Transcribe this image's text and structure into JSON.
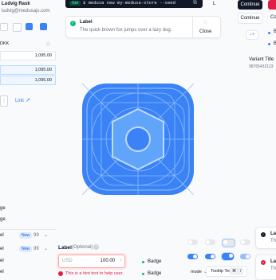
{
  "user": {
    "name": "Ludvig Rask",
    "email": "ludvig@medusajs.com"
  },
  "terminal": {
    "tag": "Get",
    "command": "$ medusa new my-medusa-store --seed",
    "side_key": "L"
  },
  "toast": {
    "title": "Label",
    "message": "The quick brown fox jumps over a lazy dog.",
    "close": "Close"
  },
  "buttons": {
    "continue_dark": "Continue",
    "continue_light": "Continue",
    "continue_light2": "Co"
  },
  "radio_items": [
    "B",
    "B"
  ],
  "variant": {
    "title": "Variant Title",
    "code": "98765432123"
  },
  "currency": {
    "code": "DKK"
  },
  "price_cells": [
    "1,095.00",
    "1,095.00",
    "1,095.00"
  ],
  "link": {
    "label": "Link"
  },
  "left_list": {
    "labels": [
      "ge",
      "ge"
    ],
    "rows": [
      {
        "label": "el",
        "badge": "New",
        "num": "99"
      },
      {
        "label": "el",
        "badge": "New",
        "num": "99"
      }
    ],
    "bottom": [
      "el",
      "el"
    ]
  },
  "price_field": {
    "label": "Label",
    "optional": "(Optional)",
    "currency": "USD",
    "value": "100.00",
    "hint": "This is a hint text to help user."
  },
  "badges": [
    "Badge",
    "Badge"
  ],
  "misc": {
    "mode": "mode",
    "tooltip": "Tooltip Text",
    "key1": "⌘",
    "key2": "/"
  },
  "right_alerts": [
    {
      "title": "La",
      "body": "Th"
    },
    {
      "title": "La",
      "body": "Th"
    }
  ],
  "colors": {
    "app_icon": "#3b82f6",
    "accent": "#3b82f6",
    "error": "#e11d48",
    "success": "#10b981"
  }
}
